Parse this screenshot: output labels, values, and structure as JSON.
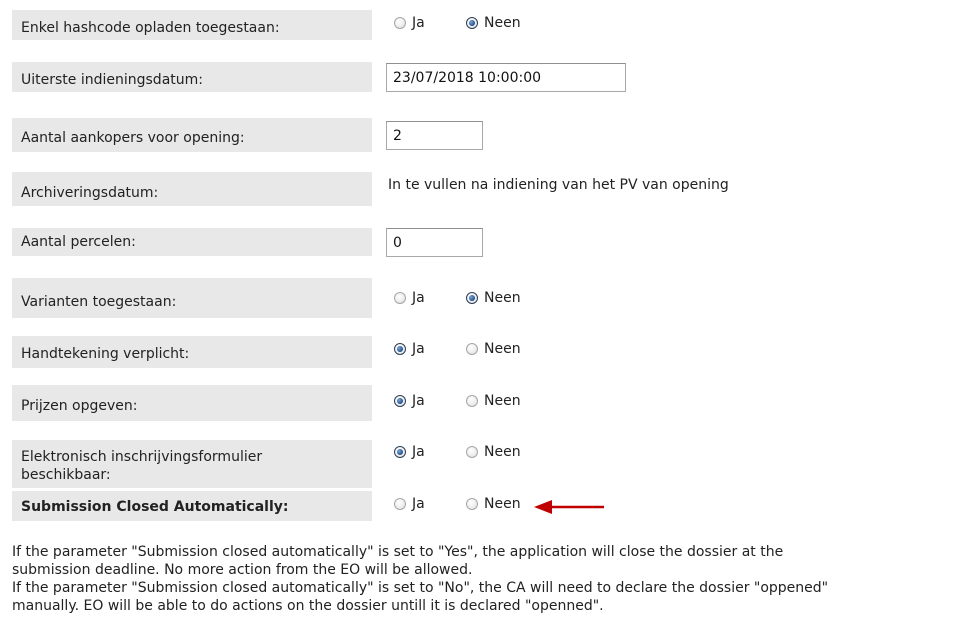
{
  "fields": {
    "hashcode": {
      "label": "Enkel hashcode opladen toegestaan:",
      "yes": "Ja",
      "no": "Neen",
      "selected": "no"
    },
    "deadline": {
      "label": "Uiterste indieningsdatum:",
      "value": "23/07/2018 10:00:00"
    },
    "buyers": {
      "label": "Aantal aankopers voor opening:",
      "value": "2"
    },
    "archive": {
      "label": "Archiveringsdatum:",
      "value": "In te vullen na indiening van het PV van opening"
    },
    "lots": {
      "label": "Aantal percelen:",
      "value": "0"
    },
    "variants": {
      "label": "Varianten toegestaan:",
      "yes": "Ja",
      "no": "Neen",
      "selected": "no"
    },
    "signature": {
      "label": "Handtekening verplicht:",
      "yes": "Ja",
      "no": "Neen",
      "selected": "yes"
    },
    "prices": {
      "label": "Prijzen opgeven:",
      "yes": "Ja",
      "no": "Neen",
      "selected": "yes"
    },
    "eform": {
      "label_line1": "Elektronisch inschrijvingsformulier",
      "label_line2": "beschikbaar:",
      "yes": "Ja",
      "no": "Neen",
      "selected": "yes"
    },
    "auto_close": {
      "label": "Submission Closed Automatically:",
      "yes": "Ja",
      "no": "Neen",
      "selected": "none"
    }
  },
  "annotation": {
    "arrow_color": "#c00000",
    "note_lines": [
      "If the parameter \"Submission closed automatically\" is set to \"Yes\", the application will close the dossier at the",
      "submission deadline. No more action from the EO will be allowed.",
      "If the parameter \"Submission closed automatically\" is set to \"No\", the CA will need to declare the dossier \"oppened\"",
      "manually. EO will be able to do actions on the dossier untill it is declared \"openned\"."
    ]
  }
}
